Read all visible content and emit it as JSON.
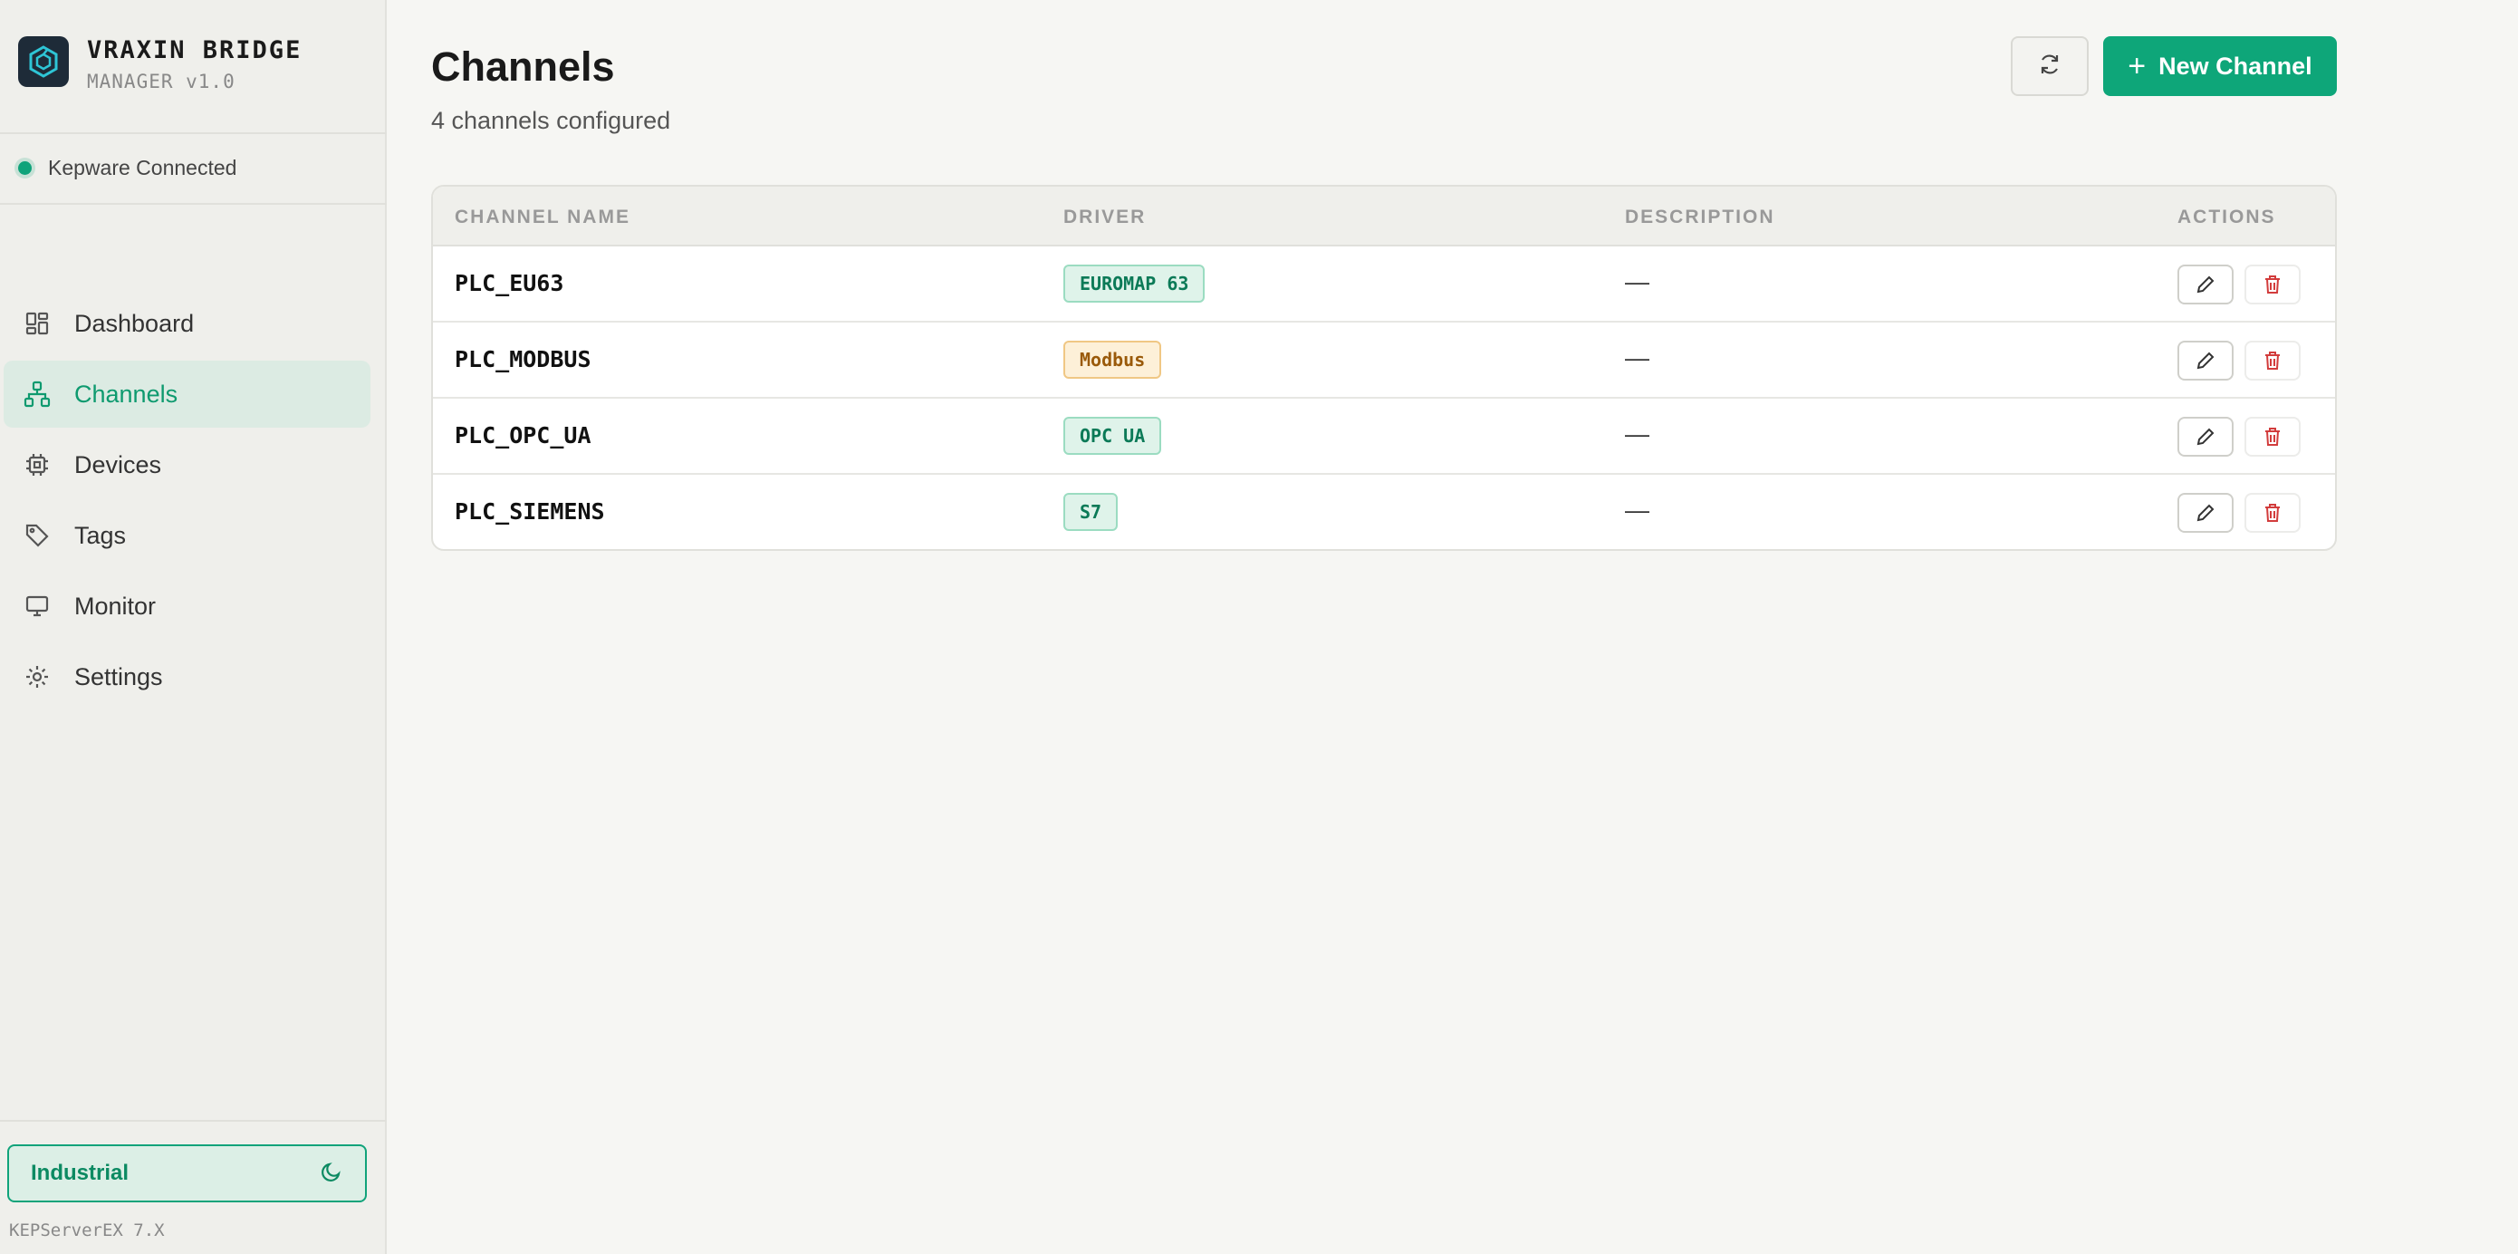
{
  "brand": {
    "title": "VRAXIN BRIDGE",
    "subtitle": "MANAGER v1.0"
  },
  "connection": {
    "status": "Kepware Connected",
    "color": "#10a37a"
  },
  "nav": {
    "items": [
      {
        "label": "Dashboard",
        "icon": "dashboard-icon"
      },
      {
        "label": "Channels",
        "icon": "channels-icon",
        "active": true
      },
      {
        "label": "Devices",
        "icon": "chip-icon"
      },
      {
        "label": "Tags",
        "icon": "tag-icon"
      },
      {
        "label": "Monitor",
        "icon": "monitor-icon"
      },
      {
        "label": "Settings",
        "icon": "gear-icon"
      }
    ]
  },
  "theme": {
    "label": "Industrial",
    "icon": "moon-icon"
  },
  "footer": {
    "version": "KEPServerEX 7.X"
  },
  "page": {
    "title": "Channels",
    "subtitle": "4 channels configured"
  },
  "toolbar": {
    "refresh_icon": "refresh-icon",
    "new_label": "New Channel"
  },
  "table": {
    "headers": {
      "name": "CHANNEL NAME",
      "driver": "DRIVER",
      "description": "DESCRIPTION",
      "actions": "ACTIONS"
    },
    "rows": [
      {
        "name": "PLC_EU63",
        "driver": "EUROMAP 63",
        "driver_style": "green",
        "description": "—"
      },
      {
        "name": "PLC_MODBUS",
        "driver": "Modbus",
        "driver_style": "amber",
        "description": "—"
      },
      {
        "name": "PLC_OPC_UA",
        "driver": "OPC UA",
        "driver_style": "green",
        "description": "—"
      },
      {
        "name": "PLC_SIEMENS",
        "driver": "S7",
        "driver_style": "green",
        "description": "—"
      }
    ]
  },
  "colors": {
    "accent": "#0ea679",
    "danger": "#d23c3c"
  }
}
